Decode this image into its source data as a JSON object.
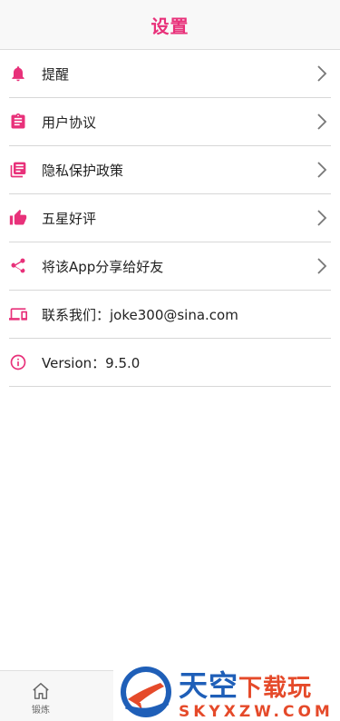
{
  "header": {
    "title": "设置"
  },
  "colors": {
    "accent": "#e8317a",
    "text": "#222222",
    "divider": "#d7d7d7"
  },
  "settings": {
    "items": [
      {
        "label": "提醒",
        "icon": "bell-icon",
        "has_chevron": true
      },
      {
        "label": "用户协议",
        "icon": "clipboard-icon",
        "has_chevron": true
      },
      {
        "label": "隐私保护政策",
        "icon": "library-books-icon",
        "has_chevron": true
      },
      {
        "label": "五星好评",
        "icon": "thumb-up-icon",
        "has_chevron": true
      },
      {
        "label": "将该App分享给好友",
        "icon": "share-icon",
        "has_chevron": true
      },
      {
        "label": "联系我们：joke300@sina.com",
        "icon": "devices-icon",
        "has_chevron": false
      },
      {
        "label": "Version：9.5.0",
        "icon": "info-icon",
        "has_chevron": false
      }
    ]
  },
  "tabbar": {
    "home_label": "锻炼"
  },
  "watermark": {
    "brand_cn_a": "天空",
    "brand_cn_b": "下载玩",
    "domain": "SKYXZW.COM"
  }
}
